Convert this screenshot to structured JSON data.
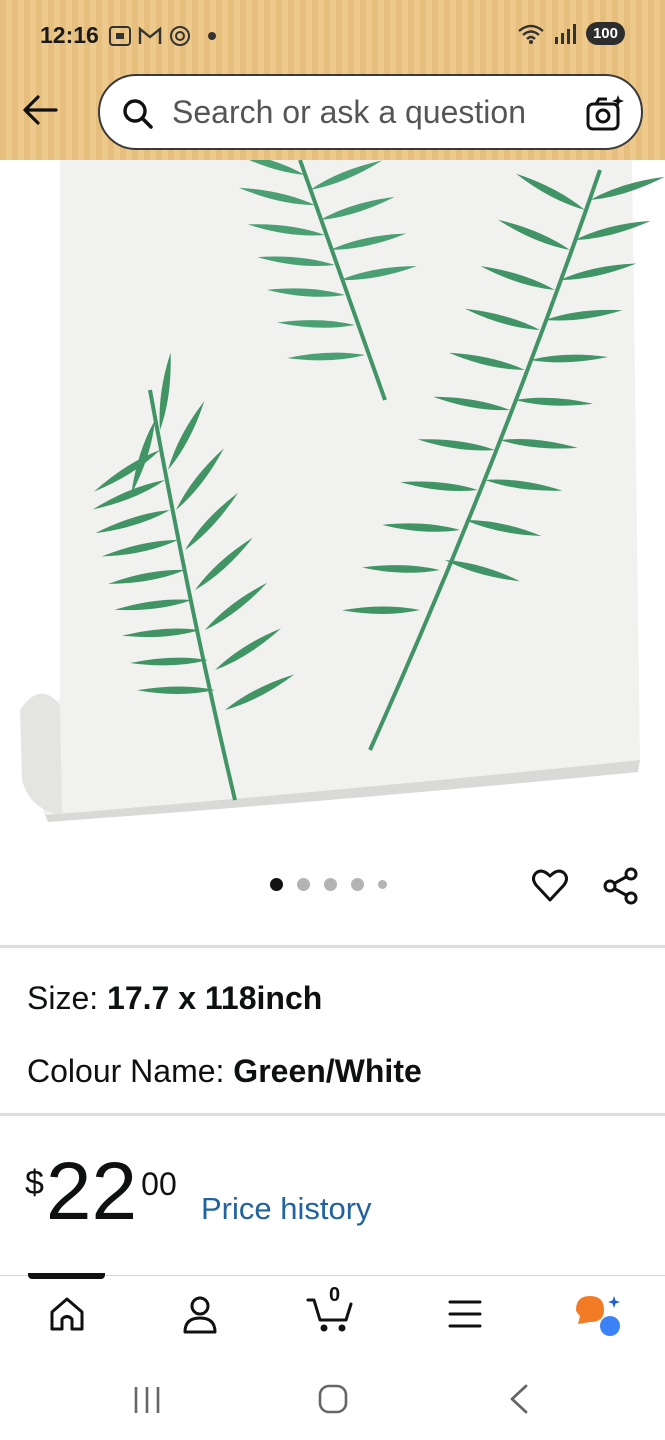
{
  "status_bar": {
    "time": "12:16",
    "battery": "100"
  },
  "header": {
    "back_icon": "arrow-left-icon",
    "search_placeholder": "Search or ask a question",
    "camera_icon": "camera-sparkle-icon"
  },
  "product": {
    "image_description_icon": "product-image",
    "carousel": {
      "count": 5,
      "active_index": 0
    },
    "size_label": "Size: ",
    "size_value": "17.7 x 118inch",
    "colour_label": "Colour Name: ",
    "colour_value": "Green/White",
    "price_symbol": "$",
    "price_whole": "22",
    "price_fraction": "00",
    "price_history_link": "Price history"
  },
  "bottom_nav": {
    "items": [
      "home-icon",
      "account-icon",
      "cart-icon",
      "menu-icon",
      "rufus-assistant-icon"
    ],
    "cart_count": "0",
    "active_index": 0
  },
  "colors": {
    "header_bg": "#e6bf7f",
    "link": "#2162a1",
    "leaf_green": "#2f8a57"
  }
}
